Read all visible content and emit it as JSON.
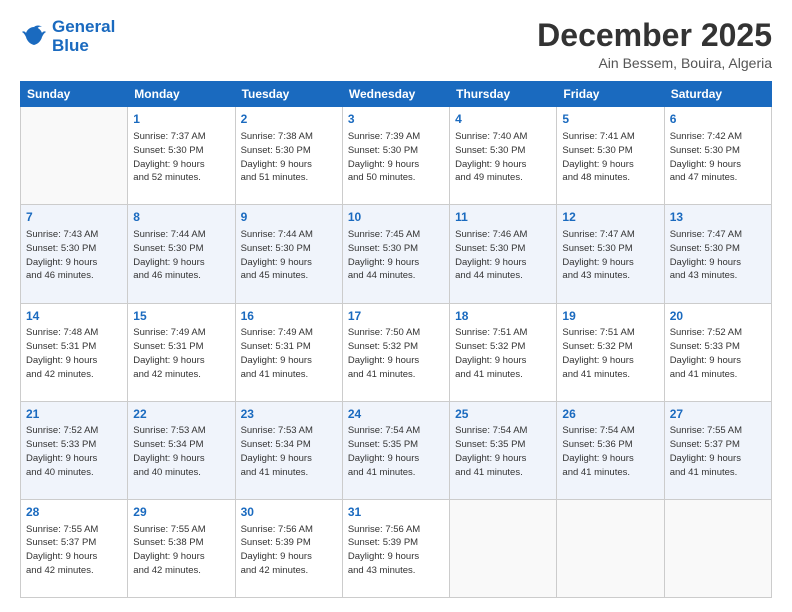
{
  "logo": {
    "line1": "General",
    "line2": "Blue"
  },
  "title": "December 2025",
  "subtitle": "Ain Bessem, Bouira, Algeria",
  "days_header": [
    "Sunday",
    "Monday",
    "Tuesday",
    "Wednesday",
    "Thursday",
    "Friday",
    "Saturday"
  ],
  "weeks": [
    [
      {
        "num": "",
        "info": ""
      },
      {
        "num": "1",
        "info": "Sunrise: 7:37 AM\nSunset: 5:30 PM\nDaylight: 9 hours\nand 52 minutes."
      },
      {
        "num": "2",
        "info": "Sunrise: 7:38 AM\nSunset: 5:30 PM\nDaylight: 9 hours\nand 51 minutes."
      },
      {
        "num": "3",
        "info": "Sunrise: 7:39 AM\nSunset: 5:30 PM\nDaylight: 9 hours\nand 50 minutes."
      },
      {
        "num": "4",
        "info": "Sunrise: 7:40 AM\nSunset: 5:30 PM\nDaylight: 9 hours\nand 49 minutes."
      },
      {
        "num": "5",
        "info": "Sunrise: 7:41 AM\nSunset: 5:30 PM\nDaylight: 9 hours\nand 48 minutes."
      },
      {
        "num": "6",
        "info": "Sunrise: 7:42 AM\nSunset: 5:30 PM\nDaylight: 9 hours\nand 47 minutes."
      }
    ],
    [
      {
        "num": "7",
        "info": "Sunrise: 7:43 AM\nSunset: 5:30 PM\nDaylight: 9 hours\nand 46 minutes."
      },
      {
        "num": "8",
        "info": "Sunrise: 7:44 AM\nSunset: 5:30 PM\nDaylight: 9 hours\nand 46 minutes."
      },
      {
        "num": "9",
        "info": "Sunrise: 7:44 AM\nSunset: 5:30 PM\nDaylight: 9 hours\nand 45 minutes."
      },
      {
        "num": "10",
        "info": "Sunrise: 7:45 AM\nSunset: 5:30 PM\nDaylight: 9 hours\nand 44 minutes."
      },
      {
        "num": "11",
        "info": "Sunrise: 7:46 AM\nSunset: 5:30 PM\nDaylight: 9 hours\nand 44 minutes."
      },
      {
        "num": "12",
        "info": "Sunrise: 7:47 AM\nSunset: 5:30 PM\nDaylight: 9 hours\nand 43 minutes."
      },
      {
        "num": "13",
        "info": "Sunrise: 7:47 AM\nSunset: 5:30 PM\nDaylight: 9 hours\nand 43 minutes."
      }
    ],
    [
      {
        "num": "14",
        "info": "Sunrise: 7:48 AM\nSunset: 5:31 PM\nDaylight: 9 hours\nand 42 minutes."
      },
      {
        "num": "15",
        "info": "Sunrise: 7:49 AM\nSunset: 5:31 PM\nDaylight: 9 hours\nand 42 minutes."
      },
      {
        "num": "16",
        "info": "Sunrise: 7:49 AM\nSunset: 5:31 PM\nDaylight: 9 hours\nand 41 minutes."
      },
      {
        "num": "17",
        "info": "Sunrise: 7:50 AM\nSunset: 5:32 PM\nDaylight: 9 hours\nand 41 minutes."
      },
      {
        "num": "18",
        "info": "Sunrise: 7:51 AM\nSunset: 5:32 PM\nDaylight: 9 hours\nand 41 minutes."
      },
      {
        "num": "19",
        "info": "Sunrise: 7:51 AM\nSunset: 5:32 PM\nDaylight: 9 hours\nand 41 minutes."
      },
      {
        "num": "20",
        "info": "Sunrise: 7:52 AM\nSunset: 5:33 PM\nDaylight: 9 hours\nand 41 minutes."
      }
    ],
    [
      {
        "num": "21",
        "info": "Sunrise: 7:52 AM\nSunset: 5:33 PM\nDaylight: 9 hours\nand 40 minutes."
      },
      {
        "num": "22",
        "info": "Sunrise: 7:53 AM\nSunset: 5:34 PM\nDaylight: 9 hours\nand 40 minutes."
      },
      {
        "num": "23",
        "info": "Sunrise: 7:53 AM\nSunset: 5:34 PM\nDaylight: 9 hours\nand 41 minutes."
      },
      {
        "num": "24",
        "info": "Sunrise: 7:54 AM\nSunset: 5:35 PM\nDaylight: 9 hours\nand 41 minutes."
      },
      {
        "num": "25",
        "info": "Sunrise: 7:54 AM\nSunset: 5:35 PM\nDaylight: 9 hours\nand 41 minutes."
      },
      {
        "num": "26",
        "info": "Sunrise: 7:54 AM\nSunset: 5:36 PM\nDaylight: 9 hours\nand 41 minutes."
      },
      {
        "num": "27",
        "info": "Sunrise: 7:55 AM\nSunset: 5:37 PM\nDaylight: 9 hours\nand 41 minutes."
      }
    ],
    [
      {
        "num": "28",
        "info": "Sunrise: 7:55 AM\nSunset: 5:37 PM\nDaylight: 9 hours\nand 42 minutes."
      },
      {
        "num": "29",
        "info": "Sunrise: 7:55 AM\nSunset: 5:38 PM\nDaylight: 9 hours\nand 42 minutes."
      },
      {
        "num": "30",
        "info": "Sunrise: 7:56 AM\nSunset: 5:39 PM\nDaylight: 9 hours\nand 42 minutes."
      },
      {
        "num": "31",
        "info": "Sunrise: 7:56 AM\nSunset: 5:39 PM\nDaylight: 9 hours\nand 43 minutes."
      },
      {
        "num": "",
        "info": ""
      },
      {
        "num": "",
        "info": ""
      },
      {
        "num": "",
        "info": ""
      }
    ]
  ]
}
